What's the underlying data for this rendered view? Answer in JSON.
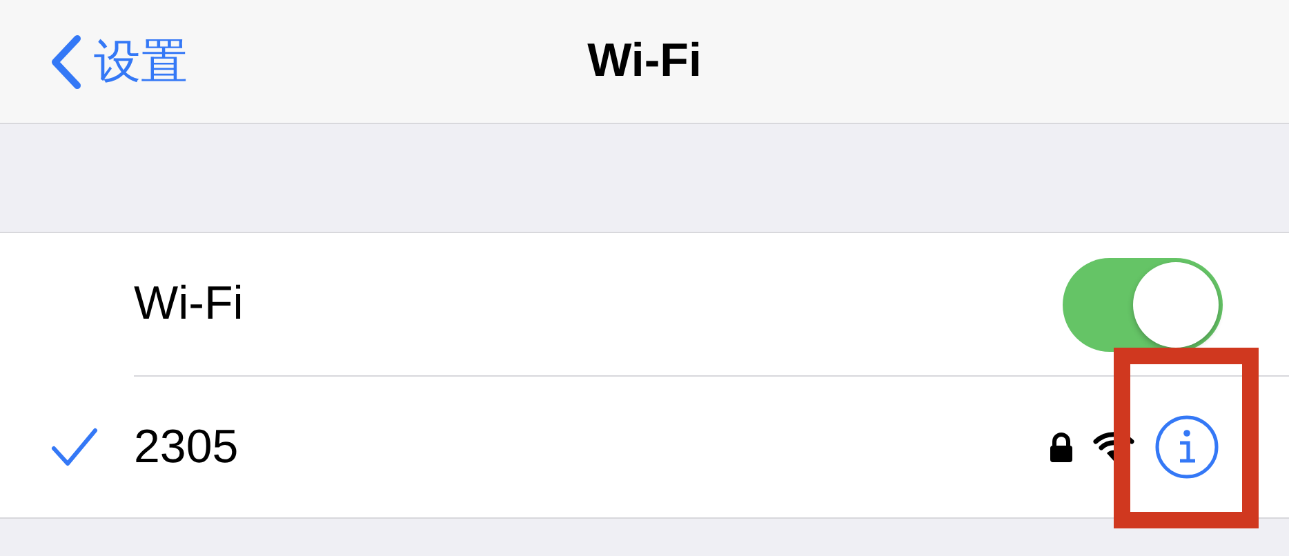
{
  "nav": {
    "back_label": "设置",
    "title": "Wi-Fi"
  },
  "wifi_row": {
    "label": "Wi-Fi",
    "on": true
  },
  "networks": [
    {
      "name": "2305",
      "selected": true,
      "secured": true
    }
  ],
  "annotations": [
    {
      "kind": "box"
    }
  ]
}
